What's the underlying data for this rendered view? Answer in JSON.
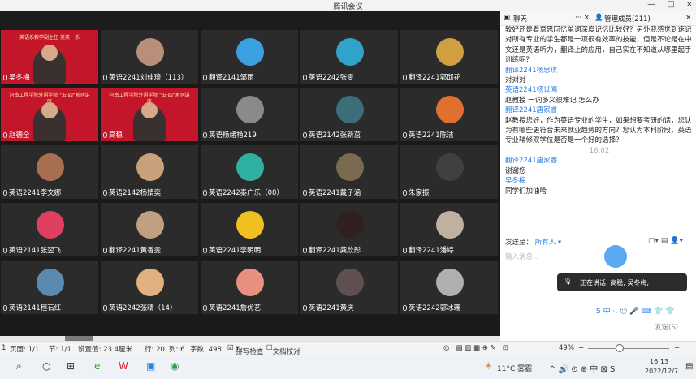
{
  "window": {
    "title": "腾讯会议",
    "min": "—",
    "max": "□",
    "close": "×"
  },
  "chat_panel": {
    "tab_chat": "聊天",
    "tab_members": "管理成员(211)",
    "messages": [
      {
        "kind": "text",
        "text": "较好还是看意思回忆单词深度记忆比较好？另外我感觉到速记对所有专业的学生都是一项很有效率的技能，但是不论是在中文还是英语听力，翻译上的应用，自己实在不知道从哪里起手训练呢？"
      },
      {
        "kind": "name",
        "text": "翻译2241杨思琪"
      },
      {
        "kind": "text",
        "text": "对对对"
      },
      {
        "kind": "name",
        "text": "英语2241杨世闻"
      },
      {
        "kind": "text",
        "text": "赵教授 一词多义很难记 怎么办"
      },
      {
        "kind": "name",
        "text": "翻译2241唐家睿"
      },
      {
        "kind": "text",
        "text": "赵教授您好，作为英语专业的学生，如果想要考研的话，您认为有哪些更符合未来就业趋势的方向？您认为本科阶段，英语专业辅修双学位是否是一个好的选择？"
      },
      {
        "kind": "time",
        "text": "16:02"
      },
      {
        "kind": "name",
        "text": "翻译2241唐家睿"
      },
      {
        "kind": "text",
        "text": "谢谢您"
      },
      {
        "kind": "name",
        "text": "吴冬梅"
      },
      {
        "kind": "text",
        "text": "同学们加油哈"
      }
    ],
    "send_to_label": "发送至：",
    "send_to_value": "所有人",
    "input_placeholder": "输入消息...",
    "speaking_label": "正在讲话: 高稳; 吴冬梅;",
    "send_button": "发送(S)"
  },
  "tiles": [
    {
      "label": "吴冬梅",
      "red": true,
      "banner": "英语系教学副主任·美英一系"
    },
    {
      "label": "英语2241刘佳琦（113）",
      "color": "#b98f7a"
    },
    {
      "label": "翻译2141邹雨",
      "color": "#3aa0e0"
    },
    {
      "label": "英语2242张雯",
      "color": "#2fa3c9"
    },
    {
      "label": "翻译2241郭邱花",
      "color": "#d0a040"
    },
    {
      "label": "赵德全",
      "red": true,
      "banner": "河南工程学院外语学院 \"五·四\"系列讲座"
    },
    {
      "label": "高稳",
      "red": true,
      "banner": "河南工程学院外语学院 \"五·四\"系列讲座"
    },
    {
      "label": "英语杨绪艳219",
      "color": "#8a8a8a"
    },
    {
      "label": "英语2142张新茁",
      "color": "#3a6f7a"
    },
    {
      "label": "英语2241陈洁",
      "color": "#e07030"
    },
    {
      "label": "英语2241李文娜",
      "color": "#a87050"
    },
    {
      "label": "英语2142杨婧奕",
      "color": "#c8a07a"
    },
    {
      "label": "英语2242秦广乐（08）",
      "color": "#30b0a0"
    },
    {
      "label": "英语2241戴子涵",
      "color": "#7a6a50"
    },
    {
      "label": "朱家振",
      "color": "#404040"
    },
    {
      "label": "英语2141张翌飞",
      "color": "#e04060"
    },
    {
      "label": "翻译2241黄香雯",
      "color": "#c0a080"
    },
    {
      "label": "英语2241李明明",
      "color": "#f0c020"
    },
    {
      "label": "翻译2241龚欣彤",
      "color": "#302020"
    },
    {
      "label": "翻译2241潘婷",
      "color": "#c0b0a0"
    },
    {
      "label": "英语2141程石红",
      "color": "#5a8ab0"
    },
    {
      "label": "英语2242张晴（14）",
      "color": "#e0b080"
    },
    {
      "label": "英语2241詹优艺",
      "color": "#e89080"
    },
    {
      "label": "英语2241黄庆",
      "color": "#605050"
    },
    {
      "label": "英语2242郭冰珊",
      "color": "#b0b0b0"
    }
  ],
  "status_bar": {
    "page": "页面: 1/1",
    "section": "节: 1/1",
    "setting": "设置值: 23.4厘米",
    "row": "行: 20",
    "col": "列: 6",
    "words": "字数: 498",
    "spell": "拼写检查",
    "proof": "文档校对",
    "zoom": "49%",
    "minus": "−",
    "plus": "+",
    "left_edge": "1"
  },
  "taskbar": {
    "weather": "11°C 雾霾",
    "time": "16:13",
    "date": "2022/12/7"
  }
}
